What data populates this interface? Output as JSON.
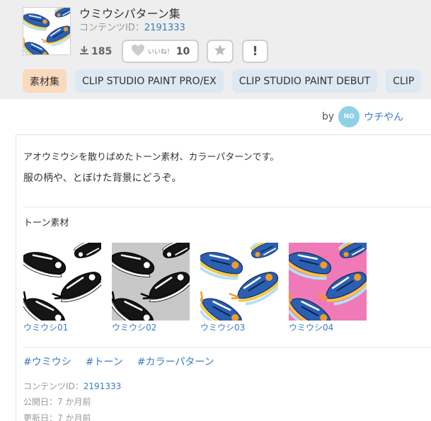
{
  "title": "ウミウシパターン集",
  "content_id_label": "コンテンツID：",
  "content_id": "2191333",
  "download_count": "185",
  "like_label": "いいね！",
  "like_count": "10",
  "report_label": "!",
  "tags": [
    "素材集",
    "CLIP STUDIO PAINT PRO/EX",
    "CLIP STUDIO PAINT DEBUT",
    "CLIP"
  ],
  "author": {
    "prefix": "by",
    "name": "ウチやん",
    "avatar_text": "NO"
  },
  "description": [
    "アオウミウシを散りばめたトーン素材、カラーパターンです。",
    "服の柄や、とぼけた背景にどうぞ。"
  ],
  "section_title": "トーン素材",
  "materials": [
    {
      "name": "ウミウシ01",
      "style": "bw"
    },
    {
      "name": "ウミウシ02",
      "style": "gray"
    },
    {
      "name": "ウミウシ03",
      "style": "color-white"
    },
    {
      "name": "ウミウシ04",
      "style": "color-pink"
    }
  ],
  "hashtags": [
    "#ウミウシ",
    "#トーン",
    "#カラーパターン"
  ],
  "meta": {
    "content_id_label": "コンテンツID：",
    "content_id": "2191333",
    "published": "公開日：7 か月前",
    "updated": "更新日：7 か月前"
  },
  "colors": {
    "link": "#3b7bbf",
    "category_tag": "#fbd9bd",
    "platform_tag": "#dde8f3",
    "header_bg": "#eeeeee",
    "pink_bg": "#f07ab8"
  }
}
